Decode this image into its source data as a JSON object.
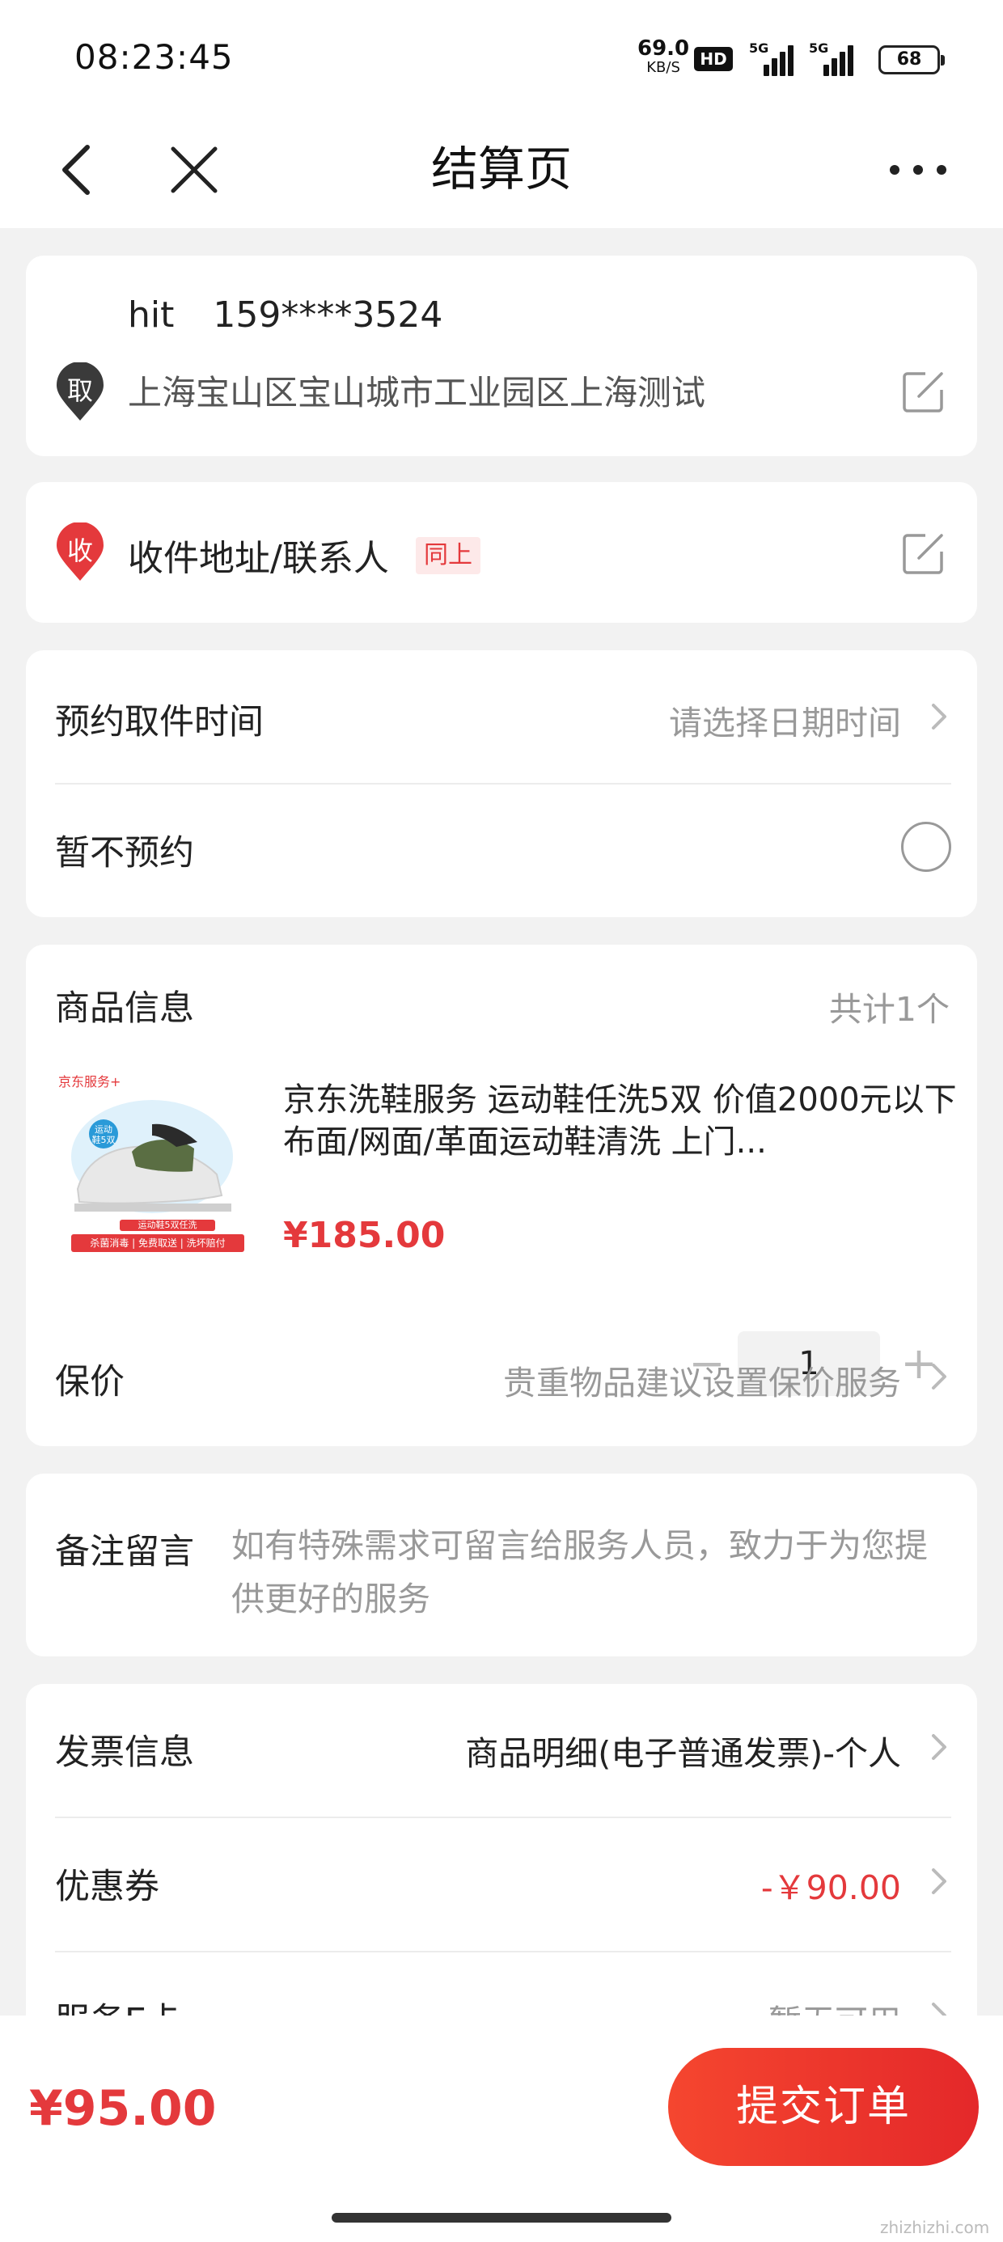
{
  "status_bar": {
    "time": "08:23:45",
    "net_speed": "69.0",
    "net_speed_unit": "KB/S",
    "hd_label": "HD",
    "sim1_label": "5G",
    "sim2_label": "5G",
    "battery": "68"
  },
  "nav": {
    "title": "结算页",
    "back_icon": "chevron-left-icon",
    "close_icon": "close-icon",
    "more_icon": "more-horizontal-icon"
  },
  "pickup": {
    "badge": "取",
    "name": "hit",
    "phone": "159****3524",
    "address": "上海宝山区宝山城市工业园区上海测试"
  },
  "delivery": {
    "badge": "收",
    "label": "收件地址/联系人",
    "tag": "同上"
  },
  "schedule": {
    "label": "预约取件时间",
    "placeholder": "请选择日期时间",
    "no_appt_label": "暂不预约"
  },
  "product": {
    "section_label": "商品信息",
    "count": "共计1个",
    "title": "京东洗鞋服务 运动鞋任洗5双 价值2000元以下布面/网面/革面运动鞋清洗 上门...",
    "price": "¥185.00",
    "qty": "1",
    "thumb_brand": "京东服务+",
    "thumb_tag": "运动鞋5双",
    "thumb_caption": "运动鞋5双任洗",
    "thumb_banner": "杀菌消毒 | 免费取送 | 洗坏赔付",
    "insurance_label": "保价",
    "insurance_value": "贵重物品建议设置保价服务"
  },
  "remark": {
    "label": "备注留言",
    "placeholder": "如有特殊需求可留言给服务人员，致力于为您提供更好的服务"
  },
  "invoice": {
    "label": "发票信息",
    "value": "商品明细(电子普通发票)-个人",
    "coupon_label": "优惠券",
    "coupon_value": "-￥90.00",
    "ecard_label": "服务E卡",
    "ecard_value": "暂无可用"
  },
  "footer": {
    "total": "¥95.00",
    "submit": "提交订单",
    "watermark": "zhizhizhi.com"
  },
  "colors": {
    "accent": "#e4393c",
    "tag_bg": "#fde9e9",
    "muted": "#999999"
  }
}
